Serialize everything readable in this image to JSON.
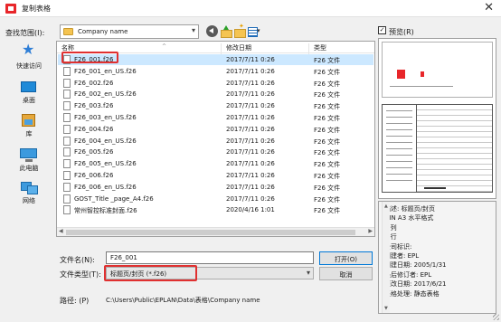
{
  "window": {
    "title": "复制表格",
    "close_glyph": "✕"
  },
  "toolbar": {
    "lookin_label": "查找范围(I):",
    "lookin_value": "Company name",
    "view_arrow": "▾"
  },
  "places": [
    {
      "label": "快速访问",
      "icon": "quick-access-star-icon"
    },
    {
      "label": "桌面",
      "icon": "desktop-icon"
    },
    {
      "label": "库",
      "icon": "library-icon"
    },
    {
      "label": "此电脑",
      "icon": "computer-icon"
    },
    {
      "label": "网络",
      "icon": "network-icon"
    }
  ],
  "filelist": {
    "columns": {
      "name": "名称",
      "date": "修改日期",
      "type": "类型"
    },
    "rows": [
      {
        "name": "F26_001.f26",
        "date": "2017/7/11 0:26",
        "type": "F26 文件",
        "selected": true
      },
      {
        "name": "F26_001_en_US.f26",
        "date": "2017/7/11 0:26",
        "type": "F26 文件"
      },
      {
        "name": "F26_002.f26",
        "date": "2017/7/11 0:26",
        "type": "F26 文件"
      },
      {
        "name": "F26_002_en_US.f26",
        "date": "2017/7/11 0:26",
        "type": "F26 文件"
      },
      {
        "name": "F26_003.f26",
        "date": "2017/7/11 0:26",
        "type": "F26 文件"
      },
      {
        "name": "F26_003_en_US.f26",
        "date": "2017/7/11 0:26",
        "type": "F26 文件"
      },
      {
        "name": "F26_004.f26",
        "date": "2017/7/11 0:26",
        "type": "F26 文件"
      },
      {
        "name": "F26_004_en_US.f26",
        "date": "2017/7/11 0:26",
        "type": "F26 文件"
      },
      {
        "name": "F26_005.f26",
        "date": "2017/7/11 0:26",
        "type": "F26 文件"
      },
      {
        "name": "F26_005_en_US.f26",
        "date": "2017/7/11 0:26",
        "type": "F26 文件"
      },
      {
        "name": "F26_006.f26",
        "date": "2017/7/11 0:26",
        "type": "F26 文件"
      },
      {
        "name": "F26_006_en_US.f26",
        "date": "2017/7/11 0:26",
        "type": "F26 文件"
      },
      {
        "name": "GOST_Title _page_A4.f26",
        "date": "2017/7/11 0:26",
        "type": "F26 文件"
      },
      {
        "name": "常州智控标准封面.f26",
        "date": "2020/4/16 1:01",
        "type": "F26 文件"
      }
    ]
  },
  "form": {
    "filename_label": "文件名(N):",
    "filename_value": "F26_001",
    "filetype_label": "文件类型(T):",
    "filetype_value": "标题页/封页 (*.f26)",
    "open_button": "打开(O)",
    "cancel_button": "取消",
    "path_label": "路径:  (P)",
    "path_value": "C:\\Users\\Public\\EPLAN\\Data\\表格\\Company name"
  },
  "preview": {
    "checkbox_label": "预览(R)",
    "checked": true,
    "properties": [
      "描述: 标题页/封页",
      "DIN A3 水平格式",
      "1 列",
      "1 行",
      "公司标识:",
      "创建者: EPL",
      "创建日期: 2005/1/31",
      "最后修订者: EPL",
      "更改日期: 2017/6/21",
      "表格处理: 静态表格"
    ]
  },
  "colors": {
    "selection": "#cce8ff",
    "highlight": "#e03030",
    "accent": "#0078d7"
  }
}
